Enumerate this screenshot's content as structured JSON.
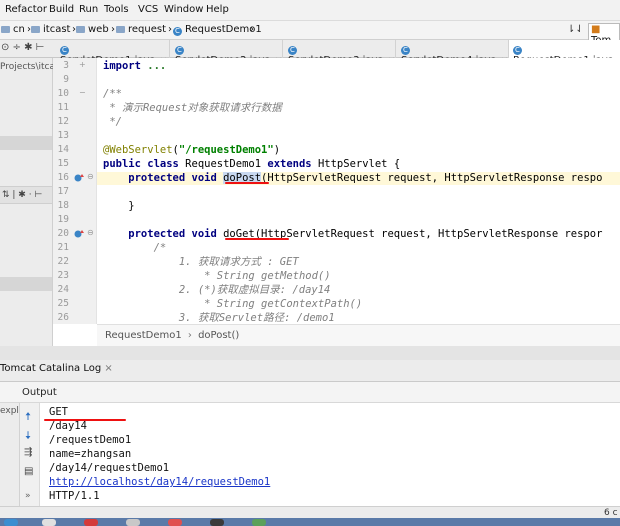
{
  "menubar": {
    "items": [
      "Refactor",
      "Build",
      "Run",
      "Tools",
      "VCS",
      "Window",
      "Help"
    ]
  },
  "navbar": {
    "crumbs": [
      "cn",
      "itcast",
      "web",
      "request",
      "RequestDemo1"
    ],
    "right_label": "Tom"
  },
  "tabs": [
    {
      "label": "ServletDemo1.java"
    },
    {
      "label": "ServletDemo2.java"
    },
    {
      "label": "ServletDemo3.java"
    },
    {
      "label": "ServletDemo4.java"
    },
    {
      "label": "RequestDemo1.java"
    }
  ],
  "project": {
    "path_fragment": "Projects\\itcas",
    "explorer_fragment": "expl"
  },
  "editor": {
    "line_numbers": [
      "3",
      "9",
      "10",
      "11",
      "12",
      "13",
      "14",
      "15",
      "16",
      "17",
      "18",
      "19",
      "20",
      "21",
      "22",
      "23",
      "24",
      "25",
      "26"
    ],
    "lines": {
      "l3_kw": "import",
      "l3_rest": " ...",
      "l10": "/**",
      "l11": " * 演示Request对象获取请求行数据",
      "l12": " */",
      "l14_ann": "@WebServlet",
      "l14_p1": "(",
      "l14_str": "\"/requestDemo1\"",
      "l14_p2": ")",
      "l15_kw1": "public class",
      "l15_name": " RequestDemo1 ",
      "l15_kw2": "extends",
      "l15_rest": " HttpServlet {",
      "l16_kw": "    protected void ",
      "l16_method": "doPost",
      "l16_rest": "(HttpServletRequest request, HttpServletResponse respo",
      "l18": "    }",
      "l20_kw": "    protected void ",
      "l20_method": "doGet",
      "l20_rest": "(HttpServletRequest request, HttpServletResponse respor",
      "l21": "        /*",
      "l22": "            1. 获取请求方式 : GET",
      "l23": "                * String getMethod()",
      "l24": "            2. (*)获取虚拟目录: /day14",
      "l25": "                * String getContextPath()",
      "l26": "            3. 获取Servlet路径: /demo1"
    },
    "breadcrumb": [
      "RequestDemo1",
      "doPost()"
    ]
  },
  "run_panel": {
    "tab_label": "Tomcat Catalina Log",
    "output_label": "Output",
    "lines": [
      "GET",
      "/day14",
      "/requestDemo1",
      "name=zhangsan",
      "/day14/requestDemo1",
      "http://localhost/day14/requestDemo1",
      "HTTP/1.1"
    ],
    "right_count": "6 c"
  },
  "colors": {
    "keyword": "#000080",
    "string": "#008000",
    "annotation": "#808000",
    "comment": "#808080",
    "link": "#1a35c8",
    "red_mark": "#e11111"
  }
}
